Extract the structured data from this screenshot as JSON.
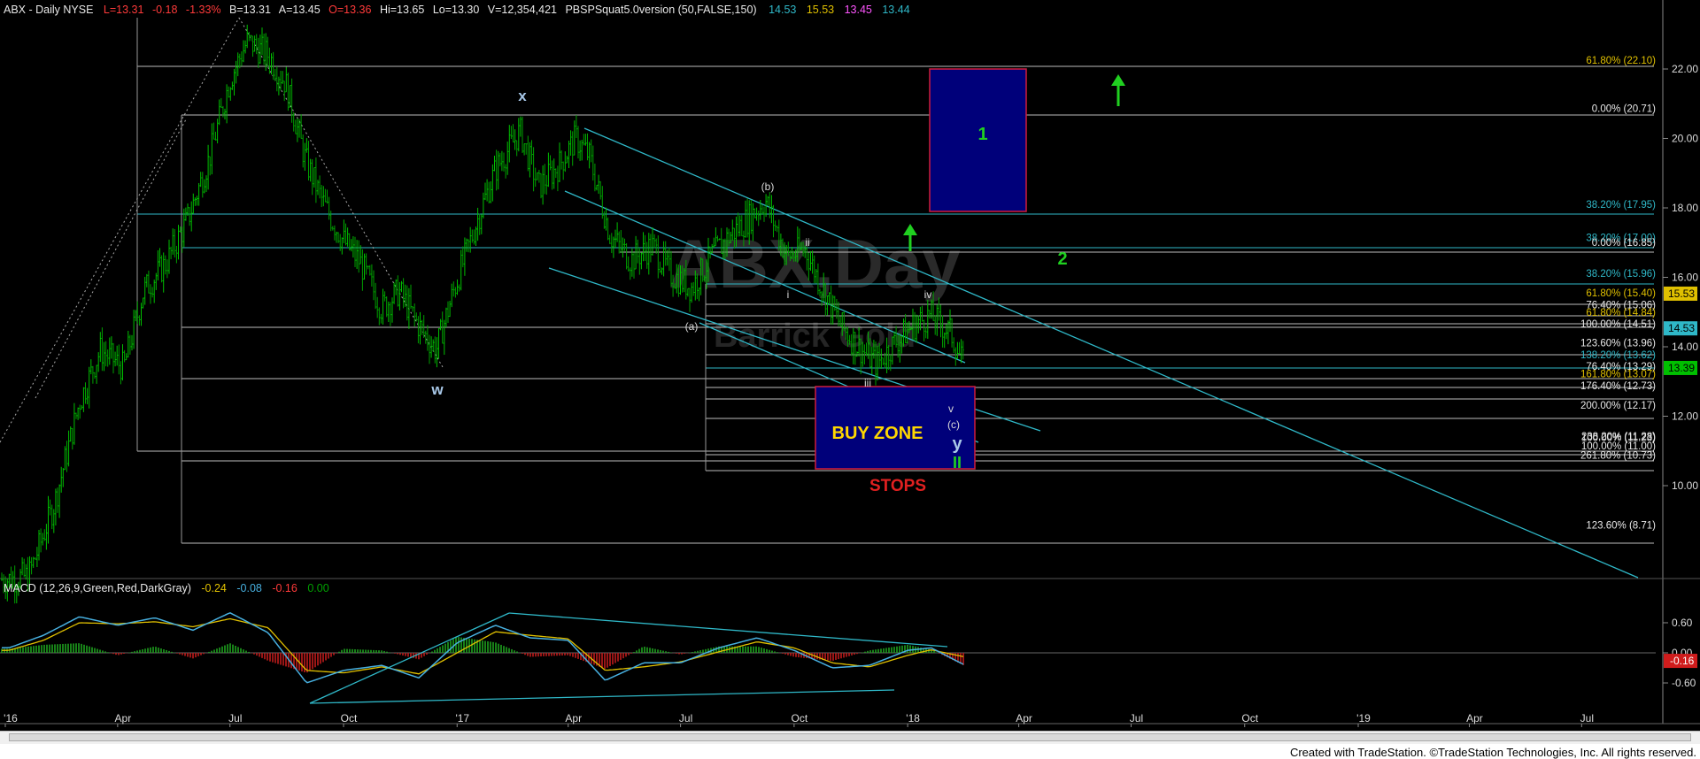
{
  "header": {
    "symbol_desc": "ABX - Daily  NYSE",
    "last": "L=13.31",
    "change": "-0.18",
    "change_pct": "-1.33%",
    "bid": "B=13.31",
    "ask": "A=13.45",
    "open": "O=13.36",
    "high": "Hi=13.65",
    "low": "Lo=13.30",
    "volume": "V=12,354,421",
    "indicator": "PBSPSquat5.0version (50,FALSE,150)",
    "ind_v1": "14.53",
    "ind_v2": "15.53",
    "ind_v3": "13.45",
    "ind_v4": "13.44"
  },
  "macd": {
    "title": "MACD (12,26,9,Green,Red,DarkGray)",
    "v1": "-0.24",
    "v2": "-0.08",
    "v3": "-0.16",
    "v4": "0.00"
  },
  "watermark": {
    "main": "ABX,Day",
    "sub": "Barrick Gold"
  },
  "annotations": {
    "buy_zone": "BUY ZONE",
    "stops": "STOPS",
    "wave_w": "w",
    "wave_x": "x",
    "wave_b": "(b)",
    "wave_a": "(a)",
    "wave_c": "(c)",
    "wave_i": "i",
    "wave_ii_small": "ii",
    "wave_iii": "iii",
    "wave_iv": "iv",
    "wave_v": "v",
    "wave_y": "y",
    "wave_II": "II",
    "wave_1": "1",
    "wave_2": "2"
  },
  "footer": {
    "credit": "Created with TradeStation. ©TradeStation Technologies, Inc. All rights reserved."
  },
  "colors": {
    "up_bar": "#00c000",
    "fib_line": "#e8e8e8",
    "channel": "#2fb8c8",
    "zone_fill": "#00007a",
    "zone_border": "#d01c3c",
    "accent_green": "#20d020",
    "macd_line": "#47b0e0",
    "signal_line": "#e0c000"
  },
  "chart_data": [
    {
      "type": "line",
      "title": "ABX - Daily  NYSE",
      "x_axis_labels": [
        "'16",
        "Apr",
        "Jul",
        "Oct",
        "'17",
        "Apr",
        "Jul",
        "Oct",
        "'18",
        "Apr",
        "Jul",
        "Oct",
        "'19",
        "Apr",
        "Jul"
      ],
      "y_ticks": [
        "10.00",
        "12.00",
        "14.00",
        "16.00",
        "18.00",
        "20.00",
        "22.00"
      ],
      "ylim": [
        8,
        23.5
      ],
      "price_labels": [
        {
          "text": "15.53",
          "value": 15.53,
          "color": "#e0c000"
        },
        {
          "text": "14.53",
          "value": 14.53,
          "color": "#2fb8c8"
        },
        {
          "text": "13.39",
          "value": 13.39,
          "color": "#00c000"
        }
      ],
      "series": [
        {
          "values": [
            [
              "2016-01-04",
              7.3
            ],
            [
              "2016-01-20",
              7.4
            ],
            [
              "2016-02-10",
              9.5
            ],
            [
              "2016-03-01",
              12.4
            ],
            [
              "2016-03-18",
              13.9
            ],
            [
              "2016-04-06",
              13.4
            ],
            [
              "2016-04-22",
              15.6
            ],
            [
              "2016-05-10",
              16.4
            ],
            [
              "2016-05-27",
              17.6
            ],
            [
              "2016-06-14",
              19.4
            ],
            [
              "2016-07-01",
              21.7
            ],
            [
              "2016-07-15",
              22.8
            ],
            [
              "2016-08-01",
              22.4
            ],
            [
              "2016-08-15",
              21.6
            ],
            [
              "2016-08-31",
              19.4
            ],
            [
              "2016-09-15",
              18.1
            ],
            [
              "2016-09-30",
              17.1
            ],
            [
              "2016-10-15",
              16.4
            ],
            [
              "2016-11-01",
              15.1
            ],
            [
              "2016-11-15",
              15.6
            ],
            [
              "2016-12-01",
              14.6
            ],
            [
              "2016-12-15",
              13.9
            ],
            [
              "2016-12-30",
              15.7
            ],
            [
              "2017-01-17",
              17.6
            ],
            [
              "2017-02-01",
              19.1
            ],
            [
              "2017-02-21",
              20.2
            ],
            [
              "2017-03-08",
              18.6
            ],
            [
              "2017-03-24",
              19.2
            ],
            [
              "2017-04-07",
              20.0
            ],
            [
              "2017-04-18",
              19.5
            ],
            [
              "2017-05-05",
              17.2
            ],
            [
              "2017-05-22",
              16.5
            ],
            [
              "2017-06-08",
              16.9
            ],
            [
              "2017-06-23",
              16.1
            ],
            [
              "2017-07-10",
              15.7
            ],
            [
              "2017-07-26",
              16.6
            ],
            [
              "2017-08-10",
              17.2
            ],
            [
              "2017-08-25",
              17.7
            ],
            [
              "2017-09-08",
              18.2
            ],
            [
              "2017-09-25",
              16.6
            ],
            [
              "2017-10-10",
              16.8
            ],
            [
              "2017-10-25",
              15.6
            ],
            [
              "2017-11-08",
              14.6
            ],
            [
              "2017-11-22",
              14.0
            ],
            [
              "2017-12-07",
              13.5
            ],
            [
              "2017-12-21",
              14.1
            ],
            [
              "2018-01-05",
              14.6
            ],
            [
              "2018-01-19",
              14.9
            ],
            [
              "2018-02-05",
              14.4
            ],
            [
              "2018-02-16",
              13.39
            ]
          ]
        }
      ],
      "fib_levels": [
        {
          "label": "61.80% (22.10)",
          "value": 22.1,
          "color": "#e0c000"
        },
        {
          "label": "0.00% (20.71)",
          "value": 20.71,
          "color": "#e8e8e8"
        },
        {
          "label": "38.20% (17.95)",
          "value": 17.95,
          "color": "#2fb8c8"
        },
        {
          "label": "38.20% (17.00)",
          "value": 17.0,
          "color": "#2fb8c8"
        },
        {
          "label": "0.00% (16.85)",
          "value": 16.85,
          "color": "#e8e8e8"
        },
        {
          "label": "38.20% (15.96)",
          "value": 15.96,
          "color": "#2fb8c8"
        },
        {
          "label": "61.80% (15.40)",
          "value": 15.4,
          "color": "#e0c000"
        },
        {
          "label": "76.40% (15.06)",
          "value": 15.06,
          "color": "#e8e8e8"
        },
        {
          "label": "61.80% (14.84)",
          "value": 14.84,
          "color": "#e0c000"
        },
        {
          "label": "100.00% (14.51)",
          "value": 14.51,
          "color": "#e8e8e8"
        },
        {
          "label": "123.60% (13.96)",
          "value": 13.96,
          "color": "#e8e8e8"
        },
        {
          "label": "138.20% (13.62)",
          "value": 13.62,
          "color": "#2fb8c8"
        },
        {
          "label": "76.40% (13.29)",
          "value": 13.29,
          "color": "#e8e8e8"
        },
        {
          "label": "161.80% (13.07)",
          "value": 13.07,
          "color": "#e0c000"
        },
        {
          "label": "176.40% (12.73)",
          "value": 12.73,
          "color": "#e8e8e8"
        },
        {
          "label": "200.00% (12.17)",
          "value": 12.17,
          "color": "#e8e8e8"
        },
        {
          "label": "238.20% (11.28)",
          "value": 11.28,
          "color": "#e8e8e8"
        },
        {
          "label": "100.00% (11.23)",
          "value": 11.23,
          "color": "#e8e8e8"
        },
        {
          "label": "100.00% (11.00)",
          "value": 11.0,
          "color": "#e8e8e8"
        },
        {
          "label": "261.80% (10.73)",
          "value": 10.73,
          "color": "#e8e8e8"
        },
        {
          "label": "123.60% (8.71)",
          "value": 8.71,
          "color": "#e8e8e8"
        }
      ]
    },
    {
      "type": "line",
      "title": "MACD (12,26,9,Green,Red,DarkGray)",
      "y_ticks": [
        "0.60",
        "0.00",
        "-0.60"
      ],
      "ylim": [
        -0.85,
        1.0
      ],
      "current_label": "-0.16",
      "series": [
        {
          "values": [
            [
              "2016-01-04",
              0.1
            ],
            [
              "2016-02-01",
              0.35
            ],
            [
              "2016-03-01",
              0.72
            ],
            [
              "2016-04-01",
              0.55
            ],
            [
              "2016-05-01",
              0.7
            ],
            [
              "2016-06-01",
              0.45
            ],
            [
              "2016-07-01",
              0.8
            ],
            [
              "2016-08-01",
              0.4
            ],
            [
              "2016-09-01",
              -0.6
            ],
            [
              "2016-10-01",
              -0.35
            ],
            [
              "2016-11-01",
              -0.25
            ],
            [
              "2016-12-01",
              -0.5
            ],
            [
              "2017-01-01",
              0.2
            ],
            [
              "2017-02-01",
              0.55
            ],
            [
              "2017-03-01",
              0.3
            ],
            [
              "2017-04-01",
              0.25
            ],
            [
              "2017-05-01",
              -0.55
            ],
            [
              "2017-06-01",
              -0.2
            ],
            [
              "2017-07-01",
              -0.2
            ],
            [
              "2017-08-01",
              0.1
            ],
            [
              "2017-09-01",
              0.3
            ],
            [
              "2017-10-01",
              0.05
            ],
            [
              "2017-11-01",
              -0.3
            ],
            [
              "2017-12-01",
              -0.25
            ],
            [
              "2018-01-01",
              0.05
            ],
            [
              "2018-01-20",
              0.1
            ],
            [
              "2018-02-16",
              -0.24
            ]
          ]
        },
        {
          "values": [
            [
              "2016-01-04",
              0.05
            ],
            [
              "2016-02-01",
              0.25
            ],
            [
              "2016-03-01",
              0.6
            ],
            [
              "2016-04-01",
              0.58
            ],
            [
              "2016-05-01",
              0.62
            ],
            [
              "2016-06-01",
              0.52
            ],
            [
              "2016-07-01",
              0.68
            ],
            [
              "2016-08-01",
              0.5
            ],
            [
              "2016-09-01",
              -0.35
            ],
            [
              "2016-10-01",
              -0.4
            ],
            [
              "2016-11-01",
              -0.28
            ],
            [
              "2016-12-01",
              -0.42
            ],
            [
              "2017-01-01",
              0.0
            ],
            [
              "2017-02-01",
              0.42
            ],
            [
              "2017-03-01",
              0.35
            ],
            [
              "2017-04-01",
              0.28
            ],
            [
              "2017-05-01",
              -0.35
            ],
            [
              "2017-06-01",
              -0.28
            ],
            [
              "2017-07-01",
              -0.18
            ],
            [
              "2017-08-01",
              0.02
            ],
            [
              "2017-09-01",
              0.22
            ],
            [
              "2017-10-01",
              0.1
            ],
            [
              "2017-11-01",
              -0.2
            ],
            [
              "2017-12-01",
              -0.28
            ],
            [
              "2018-01-01",
              -0.05
            ],
            [
              "2018-01-20",
              0.06
            ],
            [
              "2018-02-16",
              -0.08
            ]
          ]
        }
      ]
    }
  ]
}
